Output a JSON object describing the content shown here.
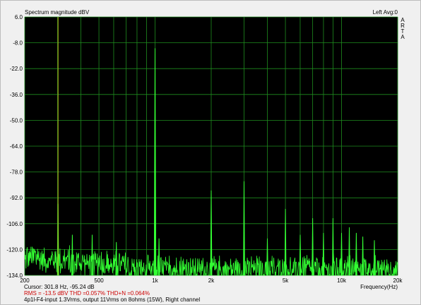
{
  "chart_data": {
    "type": "line",
    "title": "Spectrum magnitude dBV",
    "top_right_label": "Left  Avg:0",
    "watermark": [
      "A",
      "R",
      "T",
      "A"
    ],
    "xlabel": "Frequency(Hz)",
    "xscale": "log",
    "xlim": [
      200,
      20000
    ],
    "ylim": [
      -134,
      6
    ],
    "x_tick_labels": [
      "200",
      "500",
      "1k",
      "2k",
      "5k",
      "10k",
      "20k"
    ],
    "x_tick_values": [
      200,
      500,
      1000,
      2000,
      5000,
      10000,
      20000
    ],
    "y_tick_labels": [
      "6.0",
      "-8.0",
      "-22.0",
      "-36.0",
      "-50.0",
      "-64.0",
      "-78.0",
      "-92.0",
      "-106.0",
      "-120.0",
      "-134.0"
    ],
    "y_tick_values": [
      6,
      -8,
      -22,
      -36,
      -50,
      -64,
      -78,
      -92,
      -106,
      -120,
      -134
    ],
    "grid": true,
    "cursor_freq": 301.8,
    "noise_floor": -128,
    "peaks": [
      {
        "x": 301.8,
        "y": -95.2
      },
      {
        "x": 360,
        "y": -112
      },
      {
        "x": 460,
        "y": -112
      },
      {
        "x": 620,
        "y": -116
      },
      {
        "x": 1000,
        "y": -11
      },
      {
        "x": 1050,
        "y": -114
      },
      {
        "x": 2000,
        "y": -88
      },
      {
        "x": 3000,
        "y": -83
      },
      {
        "x": 4000,
        "y": -114
      },
      {
        "x": 5000,
        "y": -98
      },
      {
        "x": 6000,
        "y": -112
      },
      {
        "x": 7000,
        "y": -103
      },
      {
        "x": 8000,
        "y": -111
      },
      {
        "x": 9000,
        "y": -103
      },
      {
        "x": 10000,
        "y": -111
      },
      {
        "x": 11000,
        "y": -108
      },
      {
        "x": 12000,
        "y": -111
      },
      {
        "x": 13000,
        "y": -113
      },
      {
        "x": 15000,
        "y": -115
      }
    ],
    "colors": {
      "plot_bg": "#000000",
      "grid": "#1e8c1e",
      "trace": "#33ff33",
      "cursor": "#bdbd1e"
    }
  },
  "info": {
    "cursor": "Cursor:   301.8 Hz, -95.24 dB",
    "rms": "RMS =  -13.5 dBV   THD =0.057%   THD+N =0.064%",
    "caption": "4p1l-F4-input 1.3Vrms, output 11Vrms on 8ohms (15W), Right channel"
  }
}
